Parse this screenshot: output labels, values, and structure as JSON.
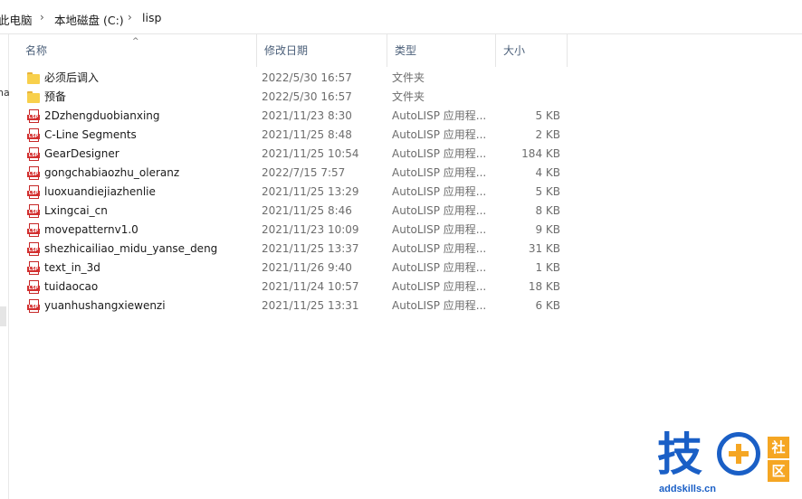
{
  "breadcrumb": [
    "此电脑",
    "本地磁盘 (C:)",
    "lisp"
  ],
  "left_pane_text": "na",
  "columns": {
    "name": "名称",
    "date": "修改日期",
    "type": "类型",
    "size": "大小"
  },
  "files": [
    {
      "icon": "folder-icon",
      "name": "必须后调入",
      "date": "2022/5/30 16:57",
      "type": "文件夹",
      "size": ""
    },
    {
      "icon": "folder-icon",
      "name": "预备",
      "date": "2022/5/30 16:57",
      "type": "文件夹",
      "size": ""
    },
    {
      "icon": "lsp-file-icon",
      "name": "2Dzhengduobianxing",
      "date": "2021/11/23 8:30",
      "type": "AutoLISP 应用程...",
      "size": "5 KB"
    },
    {
      "icon": "lsp-file-icon",
      "name": "C-Line Segments",
      "date": "2021/11/25 8:48",
      "type": "AutoLISP 应用程...",
      "size": "2 KB"
    },
    {
      "icon": "lsp-file-icon",
      "name": "GearDesigner",
      "date": "2021/11/25 10:54",
      "type": "AutoLISP 应用程...",
      "size": "184 KB"
    },
    {
      "icon": "lsp-file-icon",
      "name": "gongchabiaozhu_oleranz",
      "date": "2022/7/15 7:57",
      "type": "AutoLISP 应用程...",
      "size": "4 KB"
    },
    {
      "icon": "lsp-file-icon",
      "name": "luoxuandiejiazhenlie",
      "date": "2021/11/25 13:29",
      "type": "AutoLISP 应用程...",
      "size": "5 KB"
    },
    {
      "icon": "lsp-file-icon",
      "name": "Lxingcai_cn",
      "date": "2021/11/25 8:46",
      "type": "AutoLISP 应用程...",
      "size": "8 KB"
    },
    {
      "icon": "lsp-file-icon",
      "name": "movepatternv1.0",
      "date": "2021/11/23 10:09",
      "type": "AutoLISP 应用程...",
      "size": "9 KB"
    },
    {
      "icon": "lsp-file-icon",
      "name": "shezhicailiao_midu_yanse_deng",
      "date": "2021/11/25 13:37",
      "type": "AutoLISP 应用程...",
      "size": "31 KB"
    },
    {
      "icon": "lsp-file-icon",
      "name": "text_in_3d",
      "date": "2021/11/26 9:40",
      "type": "AutoLISP 应用程...",
      "size": "1 KB"
    },
    {
      "icon": "lsp-file-icon",
      "name": "tuidaocao",
      "date": "2021/11/24 10:57",
      "type": "AutoLISP 应用程...",
      "size": "18 KB"
    },
    {
      "icon": "lsp-file-icon",
      "name": "yuanhushangxiewenzi",
      "date": "2021/11/25 13:31",
      "type": "AutoLISP 应用程...",
      "size": "6 KB"
    }
  ],
  "watermark": {
    "char": "技",
    "box1": "社",
    "box2": "区",
    "site": "addskills.cn"
  },
  "colors": {
    "brand_blue": "#1a5fc6",
    "brand_orange": "#f5a623",
    "lsp_red": "#d32f2f",
    "folder_yellow": "#f8d04c"
  }
}
